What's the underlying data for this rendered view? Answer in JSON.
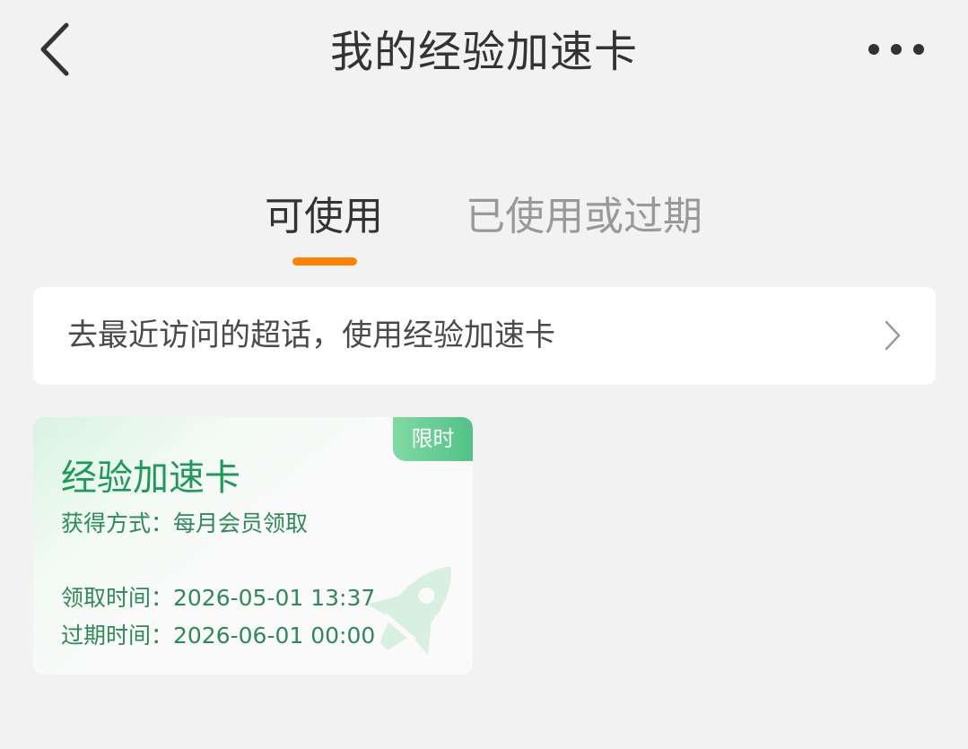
{
  "header": {
    "title": "我的经验加速卡",
    "back_icon": "chevron-left-icon",
    "more_icon": "more-horizontal-icon"
  },
  "tabs": [
    {
      "label": "可使用",
      "active": true
    },
    {
      "label": "已使用或过期",
      "active": false
    }
  ],
  "shortcut": {
    "text": "去最近访问的超话，使用经验加速卡",
    "icon": "chevron-right-icon"
  },
  "card": {
    "badge": "限时",
    "title": "经验加速卡",
    "source": "获得方式：每月会员领取",
    "receive_time": "领取时间：2026-05-01 13:37",
    "expire_time": "过期时间：2026-06-01 00:00",
    "decoration_icon": "rocket-icon"
  },
  "colors": {
    "accent": "#ff8200",
    "card_green": "#1d9a57",
    "badge_green": "#52c287",
    "background": "#f2f2f2"
  }
}
